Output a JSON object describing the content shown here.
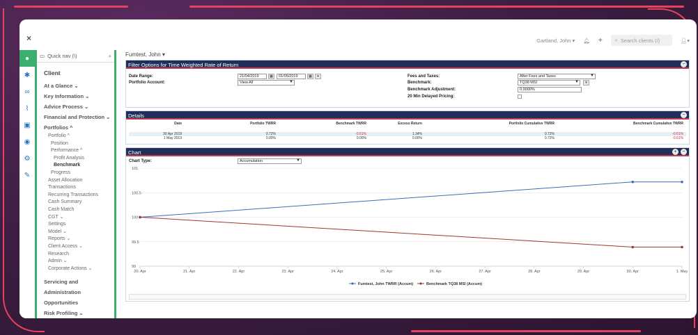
{
  "topbar": {
    "close_glyph": "×",
    "user_name": "Gartland, John ▾",
    "search_placeholder": "Search clients (/)",
    "user_glyph": "▾"
  },
  "nav": {
    "quick_nav": "Quick nav (\\)",
    "items": [
      {
        "label": "Client",
        "kind": "h"
      },
      {
        "label": "At a Glance ⌄",
        "kind": "b"
      },
      {
        "label": "Key Information ⌄",
        "kind": "b"
      },
      {
        "label": "Advice Process ⌄",
        "kind": "b"
      },
      {
        "label": "Financial and Protection ⌄",
        "kind": "b"
      },
      {
        "label": "Portfolios ^",
        "kind": "b"
      },
      {
        "label": "Portfolio ^",
        "kind": "s1"
      },
      {
        "label": "Position",
        "kind": "s2"
      },
      {
        "label": "Performance ^",
        "kind": "s2"
      },
      {
        "label": "Profit Analysis",
        "kind": "s3"
      },
      {
        "label": "Benchmark",
        "kind": "s3sel"
      },
      {
        "label": "Progress",
        "kind": "s2"
      },
      {
        "label": "Asset Allocation",
        "kind": "s1"
      },
      {
        "label": "Transactions",
        "kind": "s1"
      },
      {
        "label": "Recurring Transactions",
        "kind": "s1"
      },
      {
        "label": "Cash Summary",
        "kind": "s1"
      },
      {
        "label": "Cash Match",
        "kind": "s1"
      },
      {
        "label": "CGT ⌄",
        "kind": "s1"
      },
      {
        "label": "Settings",
        "kind": "s1"
      },
      {
        "label": "Model ⌄",
        "kind": "s1"
      },
      {
        "label": "Reports ⌄",
        "kind": "s1"
      },
      {
        "label": "Client Access ⌄",
        "kind": "s1"
      },
      {
        "label": "Research",
        "kind": "s1"
      },
      {
        "label": "Admin ⌄",
        "kind": "s1"
      },
      {
        "label": "Corporate Actions ⌄",
        "kind": "s1"
      },
      {
        "label": "Servicing and",
        "kind": "b"
      },
      {
        "label": "Administration",
        "kind": "b"
      },
      {
        "label": "Opportunities",
        "kind": "b"
      },
      {
        "label": "Risk Profiling ⌄",
        "kind": "b"
      }
    ]
  },
  "client_name": "Fumtest, John ▾",
  "filter": {
    "title": "Filter Options for Time Weighted Rate of Return",
    "date_range_label": "Date Range:",
    "date_from": "21/04/2019",
    "date_to": "01/05/2019",
    "portfolio_account_label": "Portfolio Account:",
    "portfolio_account_value": "View All",
    "fees_label": "Fees and Taxes:",
    "fees_value": "After Fees and Taxes",
    "benchmark_label": "Benchmark:",
    "benchmark_value": "TQ38 MSI",
    "bench_adj_label": "Benchmark Adjustment:",
    "bench_adj_value": "0.0000%",
    "delayed_label": "20 Min Delayed Pricing:"
  },
  "details": {
    "title": "Details",
    "headers": [
      "Date",
      "Portfolio TWRR",
      "Benchmark TWRR",
      "Excess Return",
      "Portfolio Cumulative TWRR",
      "Benchmark Cumulative TWRR"
    ],
    "rows": [
      [
        "30 Apr 2019",
        "0.72%",
        "-0.61%",
        "1.34%",
        "0.72%",
        "-0.61%"
      ],
      [
        "1 May 2019",
        "0.00%",
        "0.00%",
        "0.00%",
        "0.72%",
        "-0.61%"
      ]
    ]
  },
  "chart_panel": {
    "title": "Chart",
    "chart_type_label": "Chart Type:",
    "chart_type_value": "Accumulation"
  },
  "chart_data": {
    "type": "line",
    "categories": [
      "20. Apr",
      "21. Apr",
      "22. Apr",
      "23. Apr",
      "24. Apr",
      "25. Apr",
      "26. Apr",
      "27. Apr",
      "28. Apr",
      "29. Apr",
      "30. Apr",
      "1. May"
    ],
    "yticks": [
      "101",
      "100.5",
      "100",
      "99.5",
      "99"
    ],
    "ylim": [
      99,
      101
    ],
    "series": [
      {
        "name": "Fumtest, John TWRR (Accum)",
        "color": "#3b6db3",
        "points": [
          [
            0,
            100
          ],
          [
            10,
            100.72
          ],
          [
            11,
            100.72
          ]
        ]
      },
      {
        "name": "Benchmark TQ38 MSI (Accum)",
        "color": "#9b3a36",
        "points": [
          [
            0,
            100
          ],
          [
            10,
            99.39
          ],
          [
            11,
            99.39
          ]
        ]
      }
    ],
    "legend_position": "bottom-center",
    "grid": true
  }
}
